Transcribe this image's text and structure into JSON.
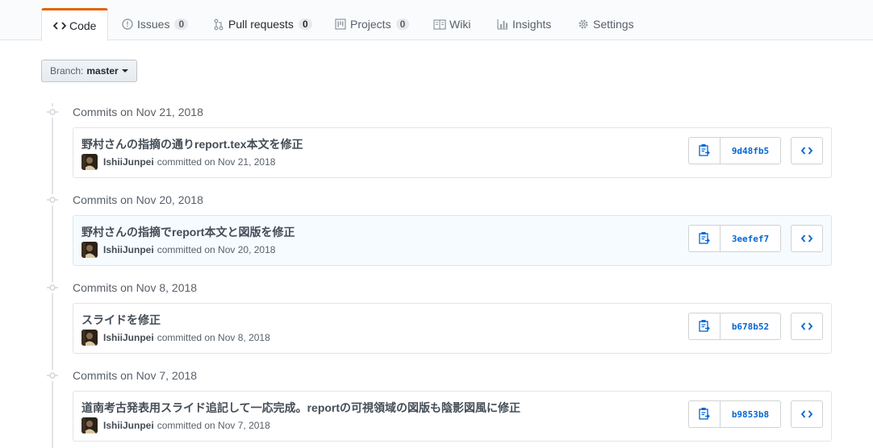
{
  "tabs": [
    {
      "label": "Code",
      "icon": "code-icon",
      "selected": true
    },
    {
      "label": "Issues",
      "icon": "issue-opened-icon",
      "count": "0"
    },
    {
      "label": "Pull requests",
      "icon": "git-pull-request-icon",
      "count": "0"
    },
    {
      "label": "Projects",
      "icon": "project-icon",
      "count": "0"
    },
    {
      "label": "Wiki",
      "icon": "book-icon"
    },
    {
      "label": "Insights",
      "icon": "graph-icon"
    },
    {
      "label": "Settings",
      "icon": "gear-icon"
    }
  ],
  "branch": {
    "prefix": "Branch:",
    "name": "master"
  },
  "groups": [
    {
      "date_label": "Commits on Nov 21, 2018",
      "commit": {
        "message": "野村さんの指摘の通りreport.tex本文を修正",
        "author": "IshiiJunpei",
        "committed": "committed on Nov 21, 2018",
        "sha": "9d48fb5"
      }
    },
    {
      "date_label": "Commits on Nov 20, 2018",
      "commit": {
        "message": "野村さんの指摘でreport本文と図版を修正",
        "author": "IshiiJunpei",
        "committed": "committed on Nov 20, 2018",
        "sha": "3eefef7"
      }
    },
    {
      "date_label": "Commits on Nov 8, 2018",
      "commit": {
        "message": "スライドを修正",
        "author": "IshiiJunpei",
        "committed": "committed on Nov 8, 2018",
        "sha": "b678b52"
      }
    },
    {
      "date_label": "Commits on Nov 7, 2018",
      "commit": {
        "message": "道南考古発表用スライド追記して一応完成。reportの可視領域の図版も陰影図風に修正",
        "author": "IshiiJunpei",
        "committed": "committed on Nov 7, 2018",
        "sha": "b9853b8"
      }
    }
  ],
  "colors": {
    "accent": "#e36209",
    "link": "#0366d6",
    "highlight_row": "#f6fbff"
  }
}
